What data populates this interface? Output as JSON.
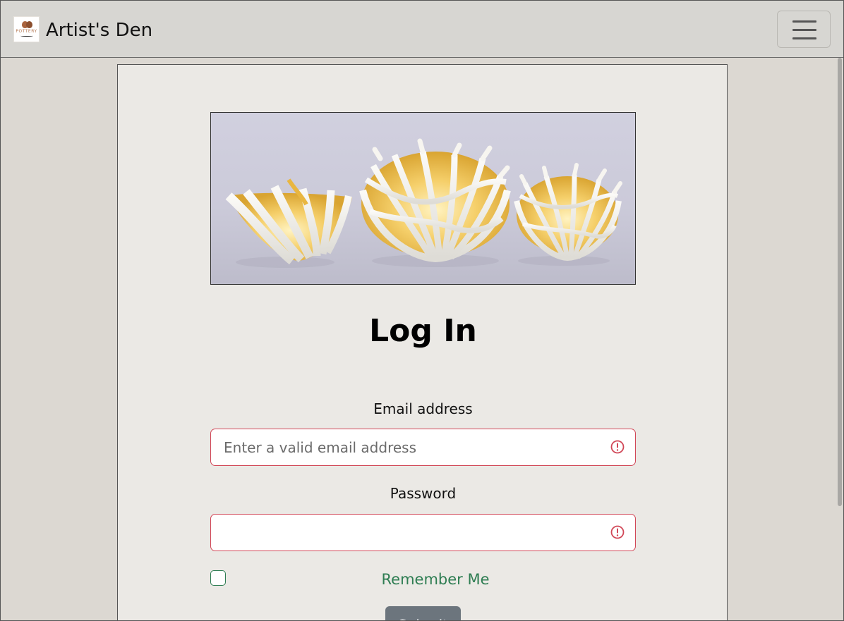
{
  "navbar": {
    "brand_name": "Artist's Den",
    "logo_text": "POTTERY"
  },
  "hero": {
    "image": "three-white-gold-sculpted-porcelain-bowls"
  },
  "login": {
    "title": "Log In",
    "email_label": "Email address",
    "email_placeholder": "Enter a valid email address",
    "email_value": "",
    "password_label": "Password",
    "password_value": "",
    "remember_label": "Remember Me",
    "remember_checked": false,
    "submit_label": "Submit"
  },
  "colors": {
    "navbar_bg": "#d7d6d2",
    "card_bg": "#ebe9e5",
    "invalid": "#d14757",
    "remember": "#2e7d52",
    "submit_bg": "#6c757d"
  }
}
